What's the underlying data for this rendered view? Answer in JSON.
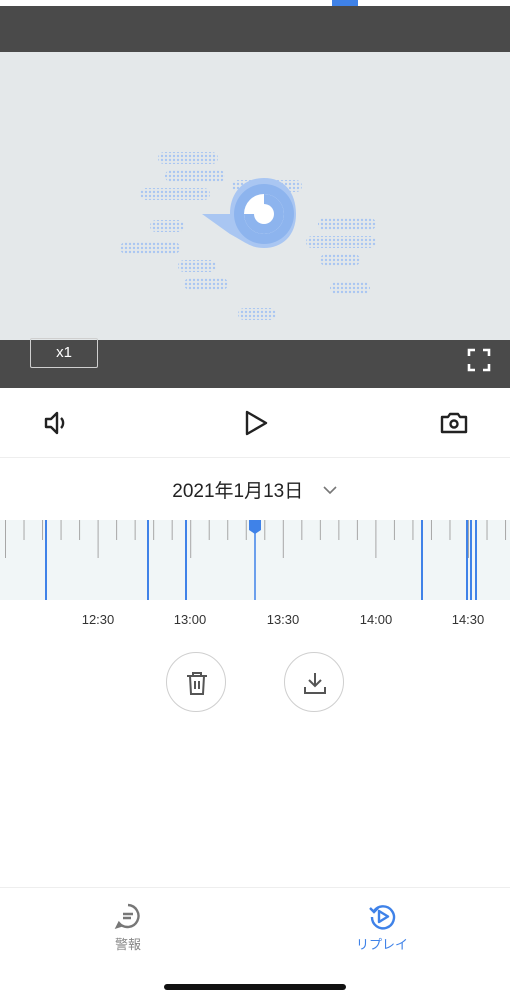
{
  "player": {
    "speed_label": "x1"
  },
  "timeline": {
    "date": "2021年1月13日",
    "time_labels": [
      "12:30",
      "13:00",
      "13:30",
      "14:00",
      "14:30"
    ]
  },
  "tabs": [
    {
      "label": "警報",
      "active": false
    },
    {
      "label": "リプレイ",
      "active": true
    }
  ],
  "colors": {
    "accent": "#3f82e8",
    "video_bar": "#4a4a4a",
    "video_bg": "#e4e8ea",
    "timeline_bg": "#f1f6f7",
    "inactive_tab": "#888888"
  },
  "icons": [
    "fullscreen-icon",
    "speaker-icon",
    "play-icon",
    "camera-icon",
    "chevron-down-icon",
    "trash-icon",
    "download-icon",
    "chat-icon",
    "replay-icon"
  ]
}
